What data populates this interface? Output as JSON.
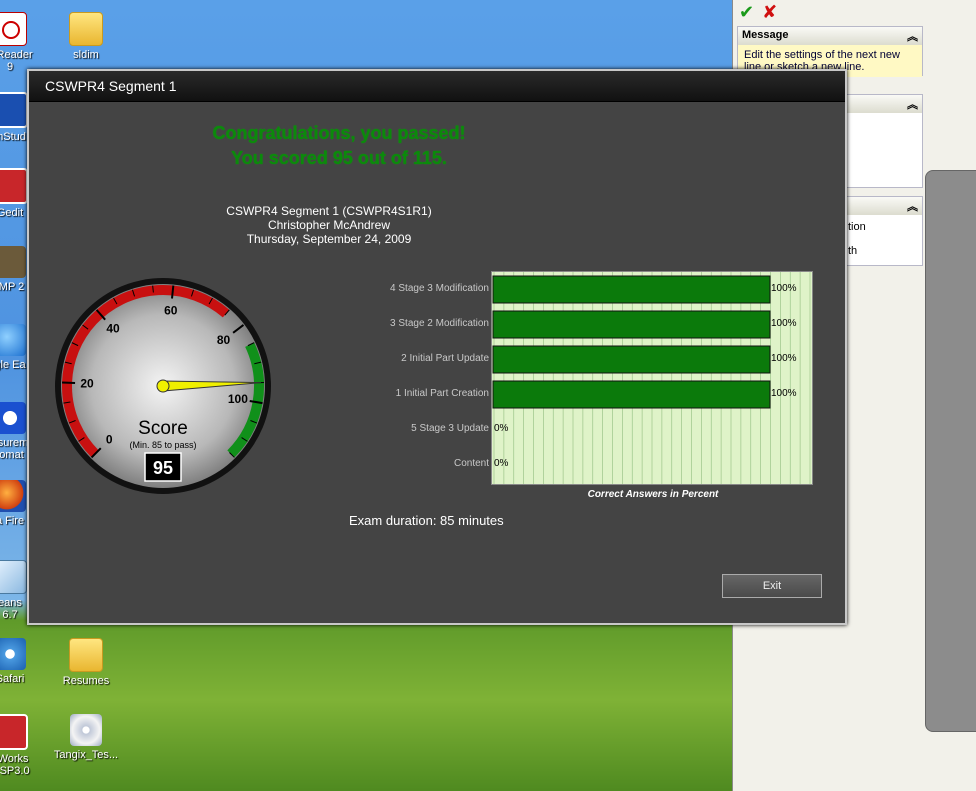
{
  "desktop": {
    "icons": [
      {
        "label": "e Reader\n9",
        "type": "pdf"
      },
      {
        "label": "sldim",
        "type": "folder"
      },
      {
        "label": "mStud",
        "type": "blueapp"
      },
      {
        "label": "Gedit",
        "type": "redapp"
      },
      {
        "label": "IMP 2",
        "type": "gimp"
      },
      {
        "label": "gle Ea",
        "type": "globe"
      },
      {
        "label": "asurem\ntomat",
        "type": "xicon"
      },
      {
        "label": "a Fire",
        "type": "fox"
      },
      {
        "label": "eans\n6.7",
        "type": "cube"
      },
      {
        "label": "Safari",
        "type": "safari"
      },
      {
        "label": "Resumes",
        "type": "folder"
      },
      {
        "label": "dWorks\n9 SP3.0",
        "type": "sw"
      },
      {
        "label": "Tangix_Tes...",
        "type": "cd"
      }
    ]
  },
  "rightpanel": {
    "message_title": "Message",
    "message_text": "Edit the settings of the next new line or sketch a new line.",
    "text_tion": "tion",
    "text_th": "th"
  },
  "dialog": {
    "title": "CSWPR4 Segment 1",
    "congrats": "Congratulations, you passed!",
    "score_line": "You scored 95 out of 115.",
    "exam_name": "CSWPR4 Segment 1 (CSWPR4S1R1)",
    "candidate": "Christopher McAndrew",
    "date": "Thursday, September 24, 2009",
    "duration": "Exam duration: 85 minutes",
    "exit_label": "Exit"
  },
  "gauge": {
    "title": "Score",
    "subtitle": "(Min. 85 to pass)",
    "value": 95,
    "value_text": "95",
    "max": 115,
    "pass_min": 85,
    "tick_labels": [
      "0",
      "20",
      "40",
      "60",
      "80",
      "100"
    ]
  },
  "chart_data": {
    "type": "bar",
    "orientation": "horizontal",
    "xlabel": "Correct Answers in Percent",
    "xlim": [
      0,
      100
    ],
    "categories": [
      "4 Stage 3 Modification",
      "3 Stage 2 Modification",
      "2 Initial Part Update",
      "1 Initial Part Creation",
      "5 Stage 3 Update",
      "Content"
    ],
    "values": [
      100,
      100,
      100,
      100,
      0,
      0
    ],
    "value_labels": [
      "100%",
      "100%",
      "100%",
      "100%",
      "0%",
      "0%"
    ],
    "bar_color": "#0b7a0b",
    "background_color": "#dff3c8",
    "grid": true
  }
}
